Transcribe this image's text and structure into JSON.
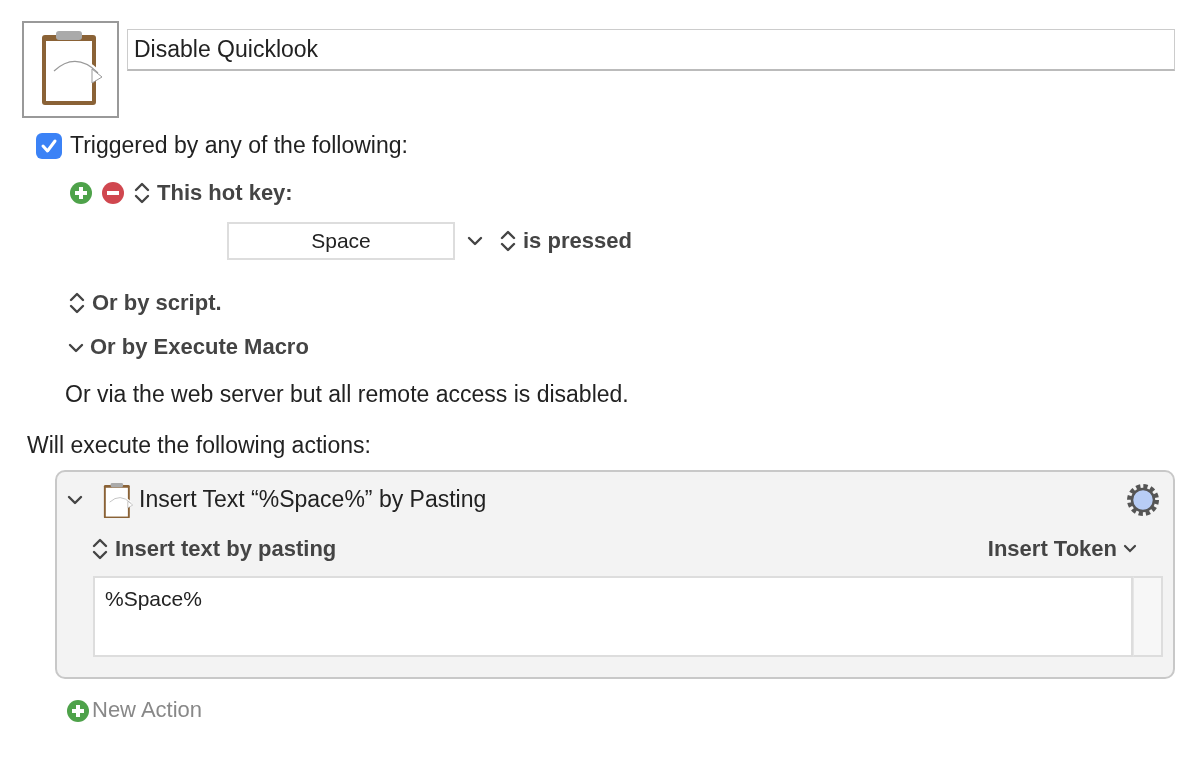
{
  "macro": {
    "name": "Disable Quicklook"
  },
  "trigger": {
    "checked": true,
    "label": "Triggered by any of the following:"
  },
  "hot_key": {
    "label": "This hot key:",
    "key": "Space",
    "condition": "is pressed"
  },
  "triggers": [
    {
      "label": "Or by script.",
      "expanded": false
    },
    {
      "label": "Or by Execute Macro",
      "expanded": true
    }
  ],
  "web_note": "Or via the web server but all remote access is disabled.",
  "actions_heading": "Will execute the following actions:",
  "actions": [
    {
      "title": "Insert Text “%Space%” by Pasting",
      "expanded": true,
      "mode": "Insert text by pasting",
      "token_menu": "Insert Token",
      "text": "%Space%"
    }
  ],
  "new_action": "New Action"
}
